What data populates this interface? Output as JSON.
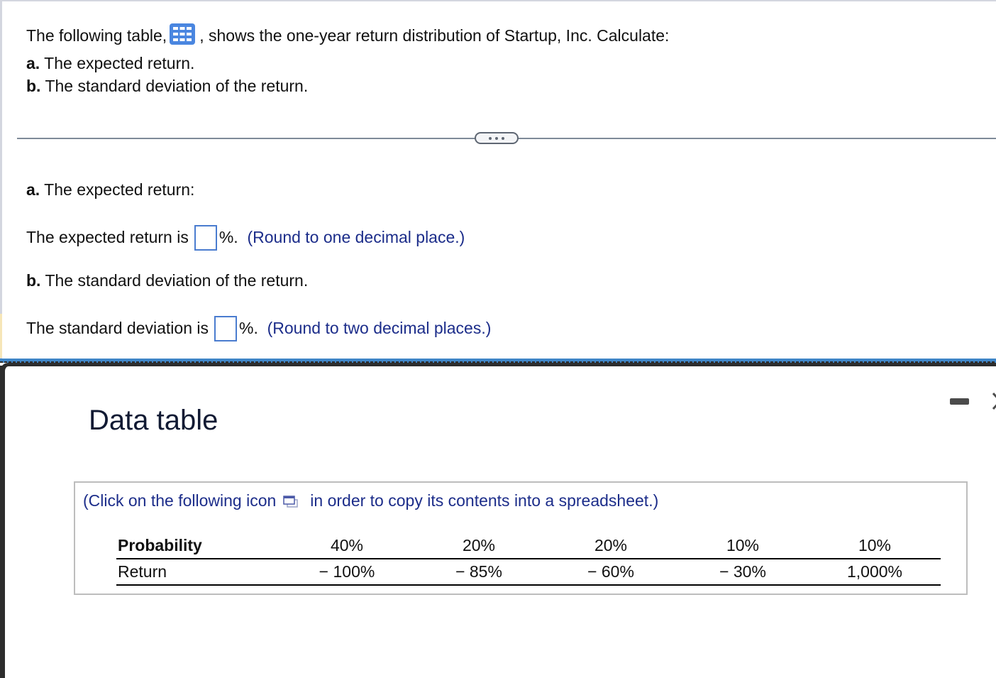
{
  "question": {
    "intro_before_icon": "The following table,",
    "intro_after_icon": ", shows the one-year return distribution of Startup, Inc. Calculate:",
    "table_icon": "grid-table-icon",
    "parts": [
      {
        "label": "a.",
        "text": "The expected return."
      },
      {
        "label": "b.",
        "text": "The standard deviation of the return."
      }
    ]
  },
  "more_button": {
    "label": "more",
    "icon": "ellipsis-icon"
  },
  "answers": {
    "part_a": {
      "heading_label": "a.",
      "heading_text": "The expected return:",
      "prompt": "The expected return is",
      "value": "",
      "unit": "%.",
      "hint": "(Round to one decimal place.)"
    },
    "part_b": {
      "heading_label": "b.",
      "heading_text": "The standard deviation of the return.",
      "prompt": "The standard deviation is",
      "value": "",
      "unit": "%.",
      "hint": "(Round to two decimal places.)"
    }
  },
  "dialog": {
    "title": "Data table",
    "minimize_icon": "minimize-icon",
    "close_icon": "close-icon",
    "copy_note_before": "(Click on the following icon",
    "copy_note_after": "in order to copy its contents into a spreadsheet.)",
    "copy_icon": "copy-to-spreadsheet-icon",
    "table": {
      "rows": [
        {
          "header": "Probability",
          "values": [
            "40%",
            "20%",
            "20%",
            "10%",
            "10%"
          ]
        },
        {
          "header": "Return",
          "values": [
            "− 100%",
            "− 85%",
            "− 60%",
            "− 30%",
            "1,000%"
          ]
        }
      ]
    }
  },
  "colors": {
    "hint_text": "#1c2d8a",
    "input_border": "#4a7ccf",
    "icon_blue": "#4a86e0",
    "dialog_accent": "#3f86c8"
  }
}
